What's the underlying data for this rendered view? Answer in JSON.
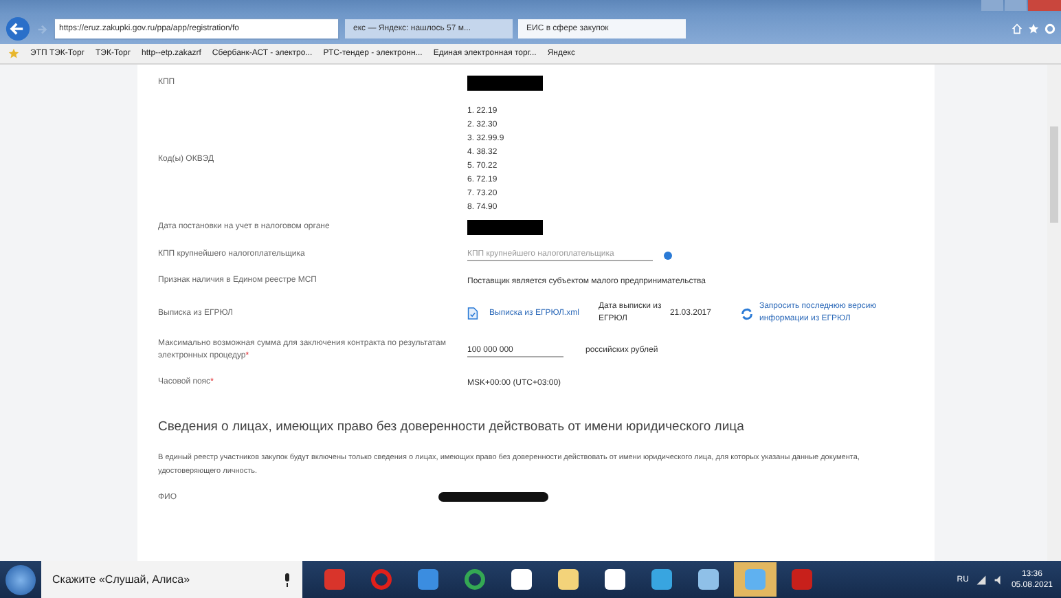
{
  "browser": {
    "address": "https://eruz.zakupki.gov.ru/ppa/app/registration/fo",
    "tabs": [
      {
        "label": "екс — Яндекс: нашлось 57 м...",
        "selected": false
      },
      {
        "label": "ЕИС в сфере закупок",
        "selected": true
      }
    ],
    "favorites": [
      "ЭТП ТЭК-Торг",
      "ТЭК-Торг",
      "http--etp.zakazrf",
      "Сбербанк-АСТ - электро...",
      "РТС-тендер - электронн...",
      "Единая электронная торг...",
      "Яндекс"
    ]
  },
  "form": {
    "rows": [
      {
        "kind": "redacted",
        "label": "КПП"
      },
      {
        "kind": "list",
        "label": "Код(ы) ОКВЭД",
        "items": [
          "1. 22.19",
          "2. 32.30",
          "3. 32.99.9",
          "4. 38.32",
          "5. 70.22",
          "6. 72.19",
          "7. 73.20",
          "8. 74.90"
        ]
      },
      {
        "kind": "redacted",
        "label": "Дата постановки на учет в налоговом органе"
      },
      {
        "kind": "field",
        "label": "КПП крупнейшего налогоплательщика",
        "placeholder": "КПП крупнейшего налогоплательщика"
      },
      {
        "kind": "text",
        "label": "Признак наличия в Едином реестре МСП",
        "value": "Поставщик является субъектом малого предпринимательства"
      },
      {
        "kind": "extract",
        "label": "Выписка из ЕГРЮЛ",
        "file": "Выписка из ЕГРЮЛ.xml",
        "date_label": "Дата выписки из ЕГРЮЛ",
        "date": "21.03.2017",
        "link": "Запросить последнюю версию информации из ЕГРЮЛ"
      },
      {
        "kind": "amount",
        "label": "Максимально возможная сумма для заключения контракта по результатам электронных процедур",
        "required_mark": "*",
        "value": "100 000 000",
        "unit": "российских рублей"
      },
      {
        "kind": "text",
        "label": "Часовой пояс",
        "required_mark": "*",
        "value": "MSK+00:00 (UTC+03:00)"
      }
    ],
    "section_title": "Сведения о лицах, имеющих право без доверенности действовать от имени юридического лица",
    "section_text": "В единый реестр участников закупок будут включены только сведения о лицах, имеющих право без доверенности действовать от имени юридического лица, для которых указаны данные документа, удостоверяющего личность.",
    "next_label": "ФИО"
  },
  "taskbar": {
    "search": "Скажите «Слушай, Алиса»",
    "language": "RU",
    "time": "13:36",
    "date": "05.08.2021"
  }
}
